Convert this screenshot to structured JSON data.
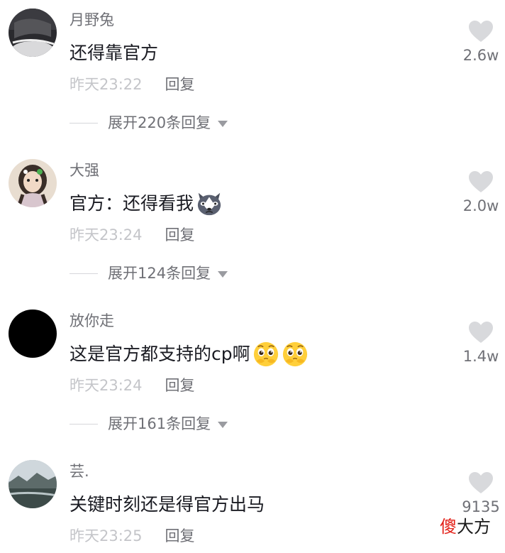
{
  "comments": [
    {
      "username": "月野兔",
      "text": "还得靠官方",
      "time": "昨天23:22",
      "reply_label": "回复",
      "expand_label": "展开220条回复",
      "likes": "2.6w",
      "avatar_icon": "avatar-dark-photo"
    },
    {
      "username": "大强",
      "text": "官方：还得看我",
      "emoji": "husky-face-emoji",
      "time": "昨天23:24",
      "reply_label": "回复",
      "expand_label": "展开124条回复",
      "likes": "2.0w",
      "avatar_icon": "avatar-girl-photo"
    },
    {
      "username": "放你走",
      "text": "这是官方都支持的cp啊",
      "emoji": "pleading-face-emoji",
      "time": "昨天23:24",
      "reply_label": "回复",
      "expand_label": "展开161条回复",
      "likes": "1.4w",
      "avatar_icon": "avatar-black-circle"
    },
    {
      "username": "芸.",
      "text": "关键时刻还是得官方出马",
      "time": "昨天23:25",
      "reply_label": "回复",
      "likes": "9135",
      "avatar_icon": "avatar-landscape-photo"
    }
  ],
  "watermark": {
    "part1": "傻",
    "part2": "大方"
  },
  "colors": {
    "username": "#6f7076",
    "time": "#c4c5c9",
    "heart": "#d8d9dc",
    "watermark_red": "#e32119"
  }
}
